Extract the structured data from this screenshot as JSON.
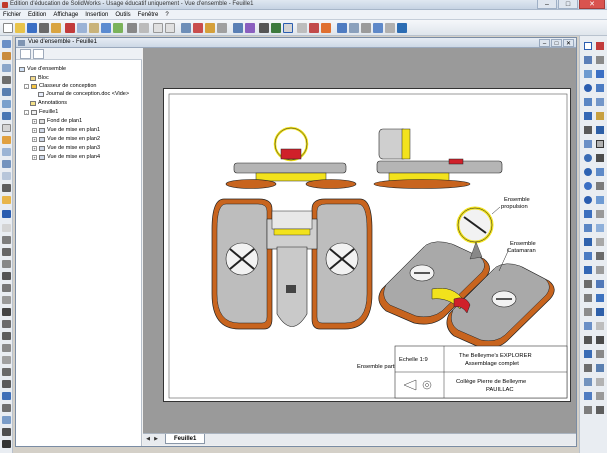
{
  "window": {
    "title": "Edition d'éducation de SolidWorks - Usage éducatif uniquement - Vue d'ensemble - Feuille1",
    "min": "–",
    "max": "□",
    "close": "✕"
  },
  "menu": [
    "Fichier",
    "Edition",
    "Affichage",
    "Insertion",
    "Outils",
    "Fenêtre",
    "?"
  ],
  "document": {
    "title": "Vue d'ensemble - Feuille1"
  },
  "tree": {
    "root": "Vue d'ensemble",
    "items": [
      {
        "label": "Bloc"
      },
      {
        "label": "Classeur de conception"
      },
      {
        "label": "Journal de conception.doc <Vide>"
      },
      {
        "label": "Annotations"
      },
      {
        "label": "Feuille1"
      },
      {
        "label": "Fond de plan1"
      },
      {
        "label": "Vue de mise en plan1"
      },
      {
        "label": "Vue de mise en plan2"
      },
      {
        "label": "Vue de mise en plan3"
      },
      {
        "label": "Vue de mise en plan4"
      }
    ]
  },
  "drawing": {
    "labels": {
      "propulsion_1": "Ensemble",
      "propulsion_2": "propulsion",
      "catamaran_1": "Ensemble",
      "catamaran_2": "Catamaran",
      "central": "Ensemble partie centrale"
    },
    "title_block": {
      "scale": "Echelle 1:9",
      "name_1": "The Belleyme's EXPLORER",
      "name_2": "Assemblage complet",
      "school_1": "Collège Pierre de Belleyme",
      "school_2": "PAUILLAC"
    }
  },
  "sheet_tab": "Feuille1",
  "colors": {
    "hull_orange": "#c8641e",
    "body_gray": "#a9a9a9",
    "accent_yellow": "#f2e21c",
    "accent_red": "#d0202a",
    "selection_blue": "#2a5db0"
  }
}
